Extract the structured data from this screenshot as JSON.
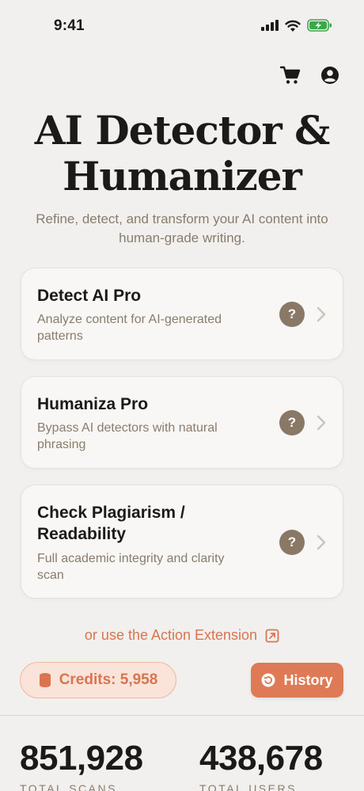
{
  "status_bar": {
    "time": "9:41"
  },
  "header": {
    "title": "AI Detector & Humanizer",
    "title_line1": "AI Detector &",
    "title_line2": "Humanizer",
    "subtitle": "Refine, detect, and transform your AI content into human-grade writing."
  },
  "cards": [
    {
      "title": "Detect AI Pro",
      "description": "Analyze content for AI-generated patterns",
      "help": "?"
    },
    {
      "title": "Humaniza Pro",
      "description": "Bypass AI detectors with natural phrasing",
      "help": "?"
    },
    {
      "title": "Check Plagiarism / Readability",
      "description": "Full academic integrity and clarity scan",
      "help": "?"
    }
  ],
  "action_extension": {
    "label": "or use the Action Extension"
  },
  "credits": {
    "label": "Credits: 5,958"
  },
  "history": {
    "label": "History"
  },
  "stats": [
    {
      "value": "851,928",
      "label": "TOTAL SCANS"
    },
    {
      "value": "438,678",
      "label": "TOTAL USERS"
    }
  ],
  "colors": {
    "accent": "#df7a56",
    "background": "#f1f0ee",
    "muted_text": "#8a7c6c",
    "badge": "#8a7866"
  },
  "icons": [
    "cart-icon",
    "profile-icon",
    "help-icon",
    "chevron-right-icon",
    "external-link-icon",
    "database-icon",
    "history-icon",
    "signal-icon",
    "wifi-icon",
    "battery-icon"
  ]
}
